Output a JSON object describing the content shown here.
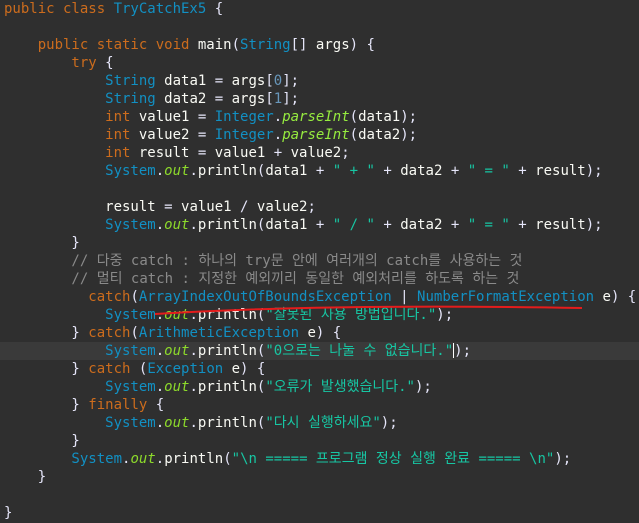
{
  "palette": {
    "keyword": "#cc6c1d",
    "type": "#1290c3",
    "identifier": "#f9faf4",
    "punct": "#e6e6fa",
    "number": "#6897bb",
    "string": "#17c6a3",
    "comment": "#8a8a8a",
    "static_field": "#8dda2b",
    "static_method": "#96ec3f",
    "error_underline": "#e41c1c",
    "current_line_bg": "#3a3a3a"
  },
  "editor": {
    "current_line": 19,
    "lines": [
      [
        [
          "kw",
          "public class "
        ],
        [
          "ty",
          "TryCatchEx5"
        ],
        [
          "pu",
          " {"
        ]
      ],
      [],
      [
        [
          "kw",
          "    public static void "
        ],
        [
          "id",
          "main"
        ],
        [
          "pu",
          "("
        ],
        [
          "ty",
          "String"
        ],
        [
          "pu",
          "[] "
        ],
        [
          "id",
          "args"
        ],
        [
          "pu",
          ") {"
        ]
      ],
      [
        [
          "kw",
          "        try "
        ],
        [
          "pu",
          "{"
        ]
      ],
      [
        [
          "ty",
          "            String "
        ],
        [
          "id",
          "data1"
        ],
        [
          "pu",
          " = "
        ],
        [
          "id",
          "args"
        ],
        [
          "pu",
          "["
        ],
        [
          "nu",
          "0"
        ],
        [
          "pu",
          "];"
        ]
      ],
      [
        [
          "ty",
          "            String "
        ],
        [
          "id",
          "data2"
        ],
        [
          "pu",
          " = "
        ],
        [
          "id",
          "args"
        ],
        [
          "pu",
          "["
        ],
        [
          "nu",
          "1"
        ],
        [
          "pu",
          "];"
        ]
      ],
      [
        [
          "kw",
          "            int "
        ],
        [
          "id",
          "value1"
        ],
        [
          "pu",
          " = "
        ],
        [
          "ty",
          "Integer"
        ],
        [
          "pu",
          "."
        ],
        [
          "sm",
          "parseInt"
        ],
        [
          "pu",
          "("
        ],
        [
          "id",
          "data1"
        ],
        [
          "pu",
          ");"
        ]
      ],
      [
        [
          "kw",
          "            int "
        ],
        [
          "id",
          "value2"
        ],
        [
          "pu",
          " = "
        ],
        [
          "ty",
          "Integer"
        ],
        [
          "pu",
          "."
        ],
        [
          "sm",
          "parseInt"
        ],
        [
          "pu",
          "("
        ],
        [
          "id",
          "data2"
        ],
        [
          "pu",
          ");"
        ]
      ],
      [
        [
          "kw",
          "            int "
        ],
        [
          "id",
          "result"
        ],
        [
          "pu",
          " = "
        ],
        [
          "id",
          "value1"
        ],
        [
          "pu",
          " + "
        ],
        [
          "id",
          "value2"
        ],
        [
          "pu",
          ";"
        ]
      ],
      [
        [
          "ty",
          "            System"
        ],
        [
          "pu",
          "."
        ],
        [
          "sf",
          "out"
        ],
        [
          "pu",
          "."
        ],
        [
          "id",
          "println"
        ],
        [
          "pu",
          "("
        ],
        [
          "id",
          "data1"
        ],
        [
          "pu",
          " + "
        ],
        [
          "st",
          "\" + \""
        ],
        [
          "pu",
          " + "
        ],
        [
          "id",
          "data2"
        ],
        [
          "pu",
          " + "
        ],
        [
          "st",
          "\" = \""
        ],
        [
          "pu",
          " + "
        ],
        [
          "id",
          "result"
        ],
        [
          "pu",
          ");"
        ]
      ],
      [],
      [
        [
          "id",
          "            result"
        ],
        [
          "pu",
          " = "
        ],
        [
          "id",
          "value1"
        ],
        [
          "pu",
          " / "
        ],
        [
          "id",
          "value2"
        ],
        [
          "pu",
          ";"
        ]
      ],
      [
        [
          "ty",
          "            System"
        ],
        [
          "pu",
          "."
        ],
        [
          "sf",
          "out"
        ],
        [
          "pu",
          "."
        ],
        [
          "id",
          "println"
        ],
        [
          "pu",
          "("
        ],
        [
          "id",
          "data1"
        ],
        [
          "pu",
          " + "
        ],
        [
          "st",
          "\" / \""
        ],
        [
          "pu",
          " + "
        ],
        [
          "id",
          "data2"
        ],
        [
          "pu",
          " + "
        ],
        [
          "st",
          "\" = \""
        ],
        [
          "pu",
          " + "
        ],
        [
          "id",
          "result"
        ],
        [
          "pu",
          ");"
        ]
      ],
      [
        [
          "pu",
          "        }"
        ]
      ],
      [
        [
          "cm",
          "        // 다중 catch : 하나의 try문 안에 여러개의 catch를 사용하는 것"
        ]
      ],
      [
        [
          "cm",
          "        // 멀티 catch : 지정한 예외끼리 동일한 예외처리를 하도록 하는 것"
        ]
      ],
      [
        [
          "kw",
          "          catch"
        ],
        [
          "pu",
          "("
        ],
        [
          "ty",
          "ArrayIndexOutOfBoundsException"
        ],
        [
          "pu",
          " | "
        ],
        [
          "ty",
          "NumberFormatException"
        ],
        [
          "pu",
          " "
        ],
        [
          "id",
          "e"
        ],
        [
          "pu",
          ") {"
        ]
      ],
      [
        [
          "ty",
          "            System"
        ],
        [
          "pu",
          "."
        ],
        [
          "sf",
          "out"
        ],
        [
          "pu",
          "."
        ],
        [
          "id",
          "println"
        ],
        [
          "pu",
          "("
        ],
        [
          "st",
          "\"잘못된 사용 방법입니다.\""
        ],
        [
          "pu",
          ");"
        ]
      ],
      [
        [
          "pu",
          "        } "
        ],
        [
          "kw",
          "catch"
        ],
        [
          "pu",
          "("
        ],
        [
          "ty",
          "ArithmeticException"
        ],
        [
          "pu",
          " "
        ],
        [
          "id",
          "e"
        ],
        [
          "pu",
          ") {"
        ]
      ],
      [
        [
          "ty",
          "            System"
        ],
        [
          "pu",
          "."
        ],
        [
          "sf",
          "out"
        ],
        [
          "pu",
          "."
        ],
        [
          "id",
          "println"
        ],
        [
          "pu",
          "("
        ],
        [
          "st",
          "\"0으로는 나눌 수 없습니다.\""
        ],
        [
          "caret",
          ""
        ],
        [
          "pu",
          ");"
        ]
      ],
      [
        [
          "pu",
          "        } "
        ],
        [
          "kw",
          "catch"
        ],
        [
          "pu",
          " ("
        ],
        [
          "ty",
          "Exception"
        ],
        [
          "pu",
          " "
        ],
        [
          "id",
          "e"
        ],
        [
          "pu",
          ") {"
        ]
      ],
      [
        [
          "ty",
          "            System"
        ],
        [
          "pu",
          "."
        ],
        [
          "sf",
          "out"
        ],
        [
          "pu",
          "."
        ],
        [
          "id",
          "println"
        ],
        [
          "pu",
          "("
        ],
        [
          "st",
          "\"오류가 발생했습니다.\""
        ],
        [
          "pu",
          ");"
        ]
      ],
      [
        [
          "pu",
          "        } "
        ],
        [
          "kw",
          "finally"
        ],
        [
          "pu",
          " {"
        ]
      ],
      [
        [
          "ty",
          "            System"
        ],
        [
          "pu",
          "."
        ],
        [
          "sf",
          "out"
        ],
        [
          "pu",
          "."
        ],
        [
          "id",
          "println"
        ],
        [
          "pu",
          "("
        ],
        [
          "st",
          "\"다시 실행하세요\""
        ],
        [
          "pu",
          ");"
        ]
      ],
      [
        [
          "pu",
          "        }"
        ]
      ],
      [
        [
          "ty",
          "        System"
        ],
        [
          "pu",
          "."
        ],
        [
          "sf",
          "out"
        ],
        [
          "pu",
          "."
        ],
        [
          "id",
          "println"
        ],
        [
          "pu",
          "("
        ],
        [
          "st",
          "\"\\n ===== 프로그램 정상 실행 완료 ===== \\n\""
        ],
        [
          "pu",
          ");"
        ]
      ],
      [
        [
          "pu",
          "    }"
        ]
      ],
      [],
      [
        [
          "pu",
          "}"
        ]
      ]
    ]
  }
}
